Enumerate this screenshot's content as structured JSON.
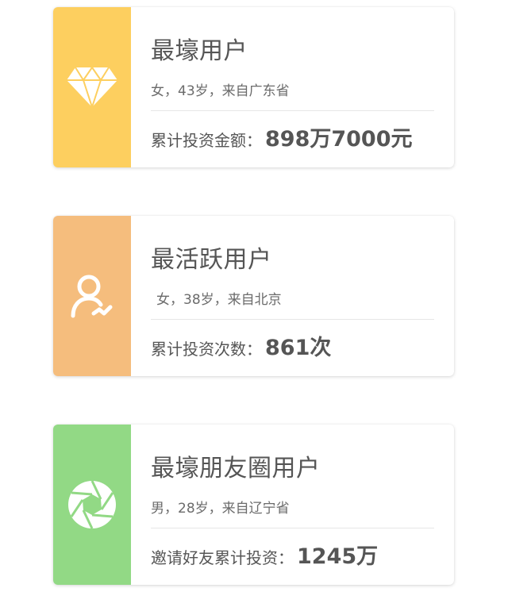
{
  "cards": [
    {
      "title": "最壕用户",
      "subtitle": "女，43岁，来自广东省",
      "stat_label": "累计投资金额：",
      "stat_value": "898万7000元",
      "icon": "diamond-icon",
      "color": "#fdcf5f"
    },
    {
      "title": "最活跃用户",
      "subtitle": "女，38岁，来自北京",
      "stat_label": "累计投资次数：",
      "stat_value": "861次",
      "icon": "active-user-icon",
      "color": "#f5bd7d"
    },
    {
      "title": "最壕朋友圈用户",
      "subtitle": "男，28岁，来自辽宁省",
      "stat_label": "邀请好友累计投资：",
      "stat_value": "1245万",
      "icon": "moments-aperture-icon",
      "color": "#92d985"
    }
  ]
}
